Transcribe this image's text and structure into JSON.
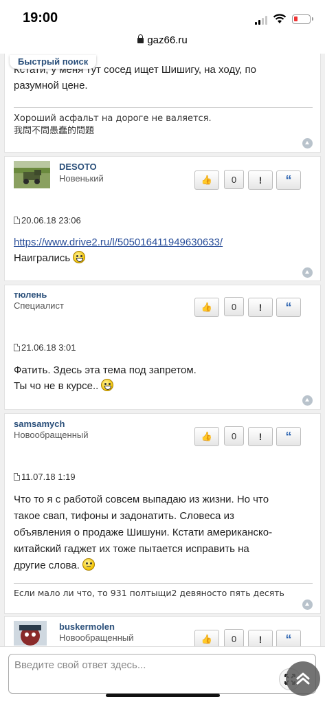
{
  "status": {
    "time": "19:00"
  },
  "browser": {
    "url": "gaz66.ru"
  },
  "quick_search": "Быстрый поиск",
  "posts": [
    {
      "body_lines": [
        "Кстати, у меня тут сосед ищет Шишигу, на ходу, по",
        "разумной цене."
      ],
      "signature": [
        "Хороший асфальт на дороге не валяется.",
        "我問不問愚蠢的問題"
      ]
    },
    {
      "username": "DESOTO",
      "rank": "Новенький",
      "likes": "0",
      "date": "20.06.18 23:06",
      "link": "https://www.drive2.ru/l/505016411949630633/",
      "body_lines": [
        "Наигрались"
      ]
    },
    {
      "username": "тюлень",
      "rank": "Специалист",
      "likes": "0",
      "date": "21.06.18 3:01",
      "body_lines": [
        "Фатить. Здесь эта тема под запретом.",
        "Ты чо не в курсе.."
      ]
    },
    {
      "username": "samsamych",
      "rank": "Новообращенный",
      "likes": "0",
      "date": "11.07.18 1:19",
      "body_lines": [
        "Что то я с работой совсем выпадаю из жизни. Но что",
        "такое свап, тифоны и задонатить. Словеса из",
        "объявления о продаже Шишуни. Кстати американско-",
        "китайский гаджет их тоже пытается исправить на",
        "другие слова."
      ],
      "signature": [
        "Если мало ли что, то 931 полтыщи2 девяносто пять десять"
      ]
    },
    {
      "username": "buskermolen",
      "rank": "Новообращенный",
      "likes": "0"
    }
  ],
  "buttons": {
    "warn": "!",
    "quote": "“"
  },
  "reply": {
    "placeholder": "Введите свой ответ здесь..."
  },
  "colors": {
    "accent": "#2a4f7a",
    "link": "#2a4f9a",
    "quote": "#2a62b0",
    "background": "#f0f0f0"
  }
}
